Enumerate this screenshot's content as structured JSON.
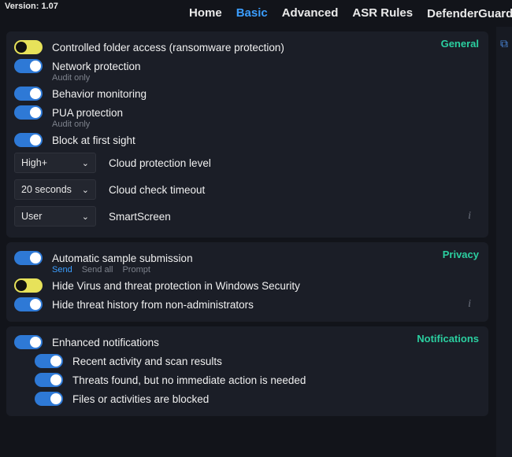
{
  "version": "Version: 1.07",
  "tabs": {
    "home": "Home",
    "basic": "Basic",
    "advanced": "Advanced",
    "asr": "ASR Rules",
    "guard": "DefenderGuard",
    "tm": "™"
  },
  "general": {
    "title": "General",
    "cfa": "Controlled folder access (ransomware protection)",
    "net": "Network protection",
    "net_sub": "Audit only",
    "behavior": "Behavior monitoring",
    "pua": "PUA protection",
    "pua_sub": "Audit only",
    "block": "Block at first sight",
    "cloud_level_val": "High+",
    "cloud_level_lbl": "Cloud protection level",
    "cloud_timeout_val": "20 seconds",
    "cloud_timeout_lbl": "Cloud check timeout",
    "smartscreen_val": "User",
    "smartscreen_lbl": "SmartScreen"
  },
  "privacy": {
    "title": "Privacy",
    "auto_sample": "Automatic sample submission",
    "send": "Send",
    "send_all": "Send all",
    "prompt": "Prompt",
    "hide_virus": "Hide Virus and threat protection in Windows Security",
    "hide_history": "Hide threat history from non-administrators"
  },
  "notifications": {
    "title": "Notifications",
    "enhanced": "Enhanced notifications",
    "recent": "Recent activity and scan results",
    "threats_found": "Threats found, but no immediate action is needed",
    "blocked": "Files or activities are blocked"
  },
  "info_char": "i"
}
